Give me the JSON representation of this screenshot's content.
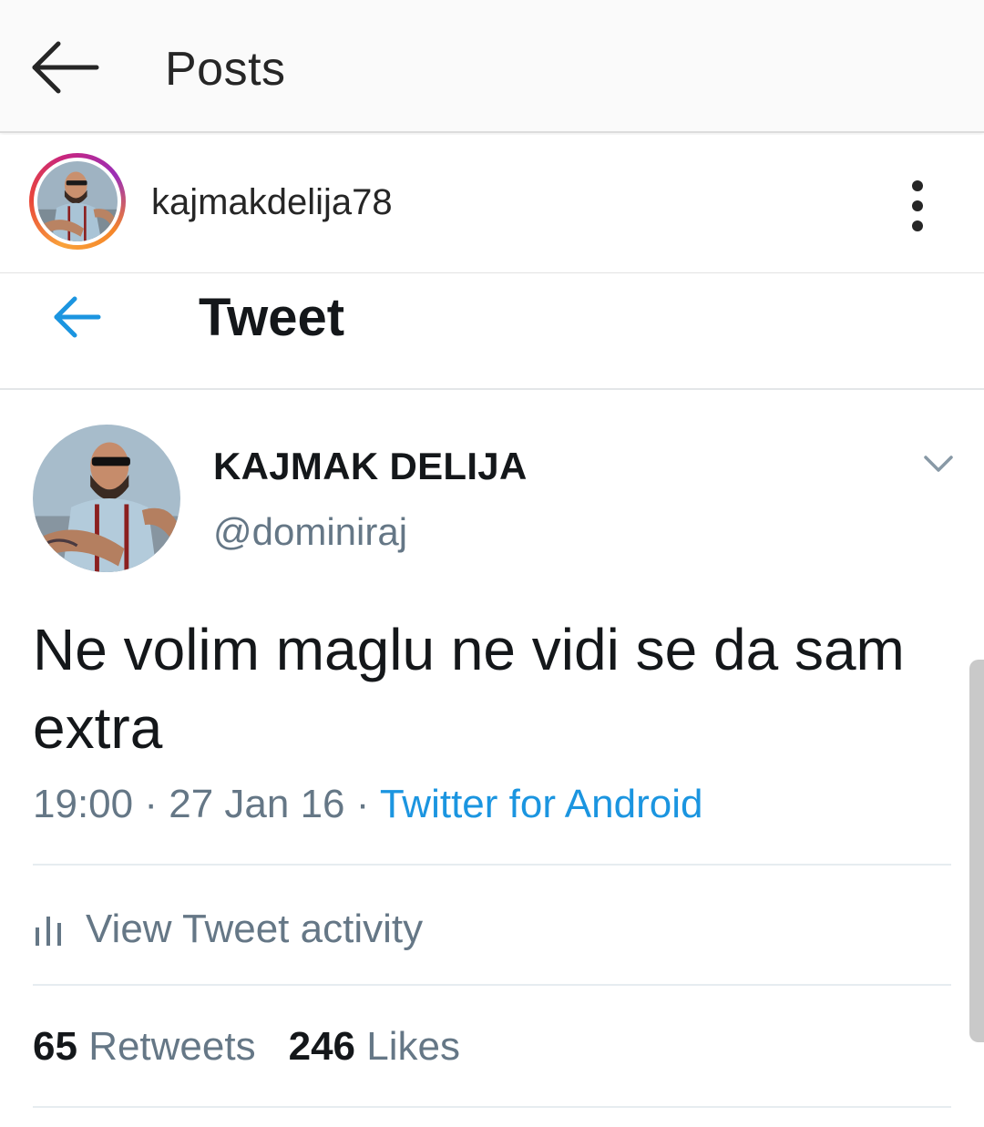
{
  "header": {
    "title": "Posts",
    "back_icon": "arrow-left-icon"
  },
  "post_owner": {
    "username": "kajmakdelija78",
    "more_icon": "more-vertical-icon"
  },
  "tweet": {
    "header_title": "Tweet",
    "back_icon": "arrow-left-icon",
    "author_name": "KAJMAK DELIJA",
    "author_handle": "@dominiraj",
    "text": "Ne volim maglu ne vidi se da sam extra",
    "time": "19:00",
    "date": "27 Jan 16",
    "separator": "·",
    "source": "Twitter for Android",
    "activity_label": "View Tweet activity",
    "activity_icon": "bar-chart-icon",
    "retweets_count": "65",
    "retweets_label": "Retweets",
    "likes_count": "246",
    "likes_label": "Likes"
  },
  "colors": {
    "twitter_blue": "#1b95e0",
    "muted": "#657786",
    "text": "#14171a"
  }
}
